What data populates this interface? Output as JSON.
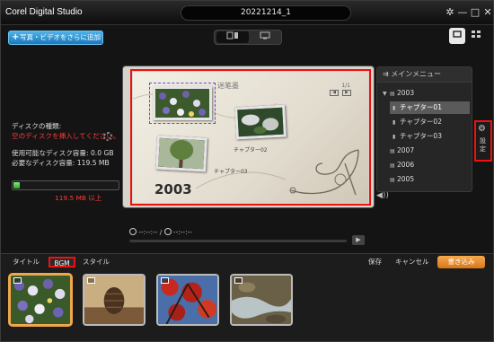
{
  "titlebar": {
    "app_title": "Corel Digital Studio",
    "project_title": "20221214_1",
    "buttons": {
      "settings": "✲",
      "minimize": "—",
      "maximize": "□",
      "close": "✕"
    }
  },
  "toolbar": {
    "add_button_label": "写真・ビデオをさらに追加",
    "mode_buttons": [
      "disc-mode-icon",
      "screen-mode-icon"
    ],
    "view_buttons": [
      "preview-view-icon",
      "grid-view-icon"
    ]
  },
  "disc_info": {
    "type_label": "ディスクの種類:",
    "type_warning": "空のディスクを挿入してください。",
    "available_capacity": "使用可能なディスク容量: 0.0 GB",
    "required_capacity": "必要なディスク容量: 119.5 MB",
    "capacity_fraction": 0.06,
    "over_capacity": "119.5 MB 以上"
  },
  "preview": {
    "deco_text": "迷笔墨",
    "page_indicator": "1/1",
    "chapter_02_label": "チャプター02",
    "chapter_03_label": "チャプター03",
    "year": "2003"
  },
  "playback": {
    "current_time": "--:--:--",
    "separator": "/",
    "total_time": "--:--:--"
  },
  "menu_panel": {
    "title": "メインメニュー",
    "items": [
      {
        "label": "2003",
        "level": 0,
        "expanded": true
      },
      {
        "label": "チャプター01",
        "level": 1,
        "selected": true
      },
      {
        "label": "チャプター02",
        "level": 1
      },
      {
        "label": "チャプター03",
        "level": 1
      },
      {
        "label": "2007",
        "level": 0
      },
      {
        "label": "2006",
        "level": 0
      },
      {
        "label": "2005",
        "level": 0
      }
    ],
    "side_settings_label": "設定"
  },
  "bottom": {
    "tabs": [
      {
        "label": "タイトル",
        "active": false
      },
      {
        "label": "BGM",
        "active": true
      },
      {
        "label": "スタイル",
        "active": false
      }
    ],
    "save_label": "保存",
    "cancel_label": "キャンセル",
    "write_label": "書き込み"
  },
  "colors": {
    "accent_blue": "#2a8fd4",
    "write_orange": "#e8882e",
    "highlight_red": "#e11111",
    "warning_red": "#ff3b3b"
  }
}
